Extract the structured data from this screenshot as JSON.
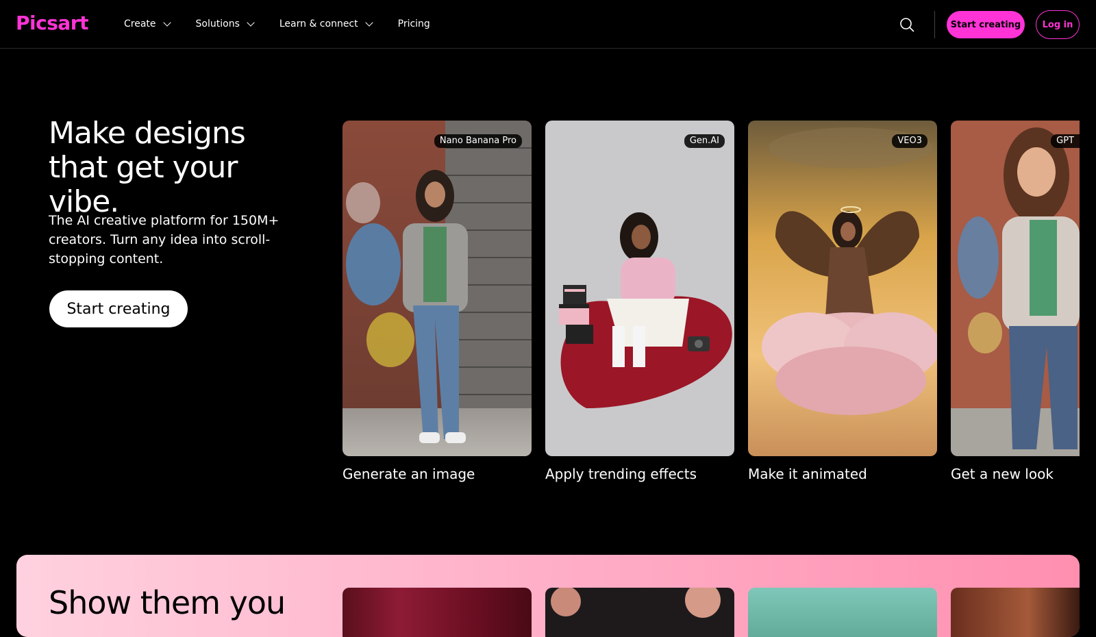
{
  "brand": {
    "logo_text": "Picsart",
    "accent": "#ff33d6"
  },
  "nav": {
    "items": [
      {
        "label": "Create",
        "has_dropdown": true
      },
      {
        "label": "Solutions",
        "has_dropdown": true
      },
      {
        "label": "Learn & connect",
        "has_dropdown": true
      },
      {
        "label": "Pricing",
        "has_dropdown": false
      }
    ]
  },
  "header_actions": {
    "search_icon": "search-icon",
    "start_label": "Start creating",
    "login_label": "Log in"
  },
  "hero": {
    "title": "Make designs that get your vibe.",
    "subtitle": "The AI creative platform for 150M+ creators. Turn any idea into scroll-stopping content.",
    "cta_label": "Start creating"
  },
  "cards": [
    {
      "badge": "Nano Banana Pro",
      "caption": "Generate an image"
    },
    {
      "badge": "Gen.AI",
      "caption": "Apply trending effects"
    },
    {
      "badge": "VEO3",
      "caption": "Make it animated"
    },
    {
      "badge": "GPT",
      "caption": "Get a new look"
    }
  ],
  "bottom": {
    "title": "Show them you"
  }
}
